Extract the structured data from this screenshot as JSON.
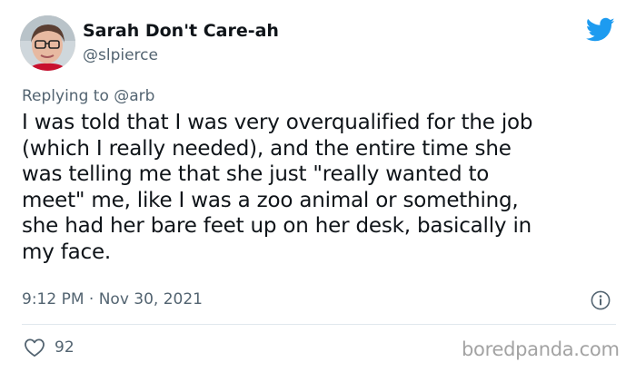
{
  "author": {
    "display_name": "Sarah Don't Care-ah",
    "handle": "@slpierce",
    "avatar_icon": "avatar-photo"
  },
  "reply": {
    "prefix": "Replying to ",
    "target": "@arb"
  },
  "tweet": {
    "text": "I was told that I was very overqualified for the job\n(which I really needed), and the entire time she\nwas telling me that she just \"really wanted to\nmeet\" me, like I was a zoo animal or something,\nshe had her bare feet up on her desk, basically in\nmy face.",
    "timestamp": "9:12 PM · Nov 30, 2021",
    "likes": "92"
  },
  "icons": {
    "brand": "twitter-bird-icon",
    "info": "info-icon",
    "like": "heart-icon"
  },
  "colors": {
    "twitter_blue": "#1d9bf0",
    "secondary_text": "#536471",
    "watermark": "#a3a3a3"
  },
  "watermark": "boredpanda.com"
}
